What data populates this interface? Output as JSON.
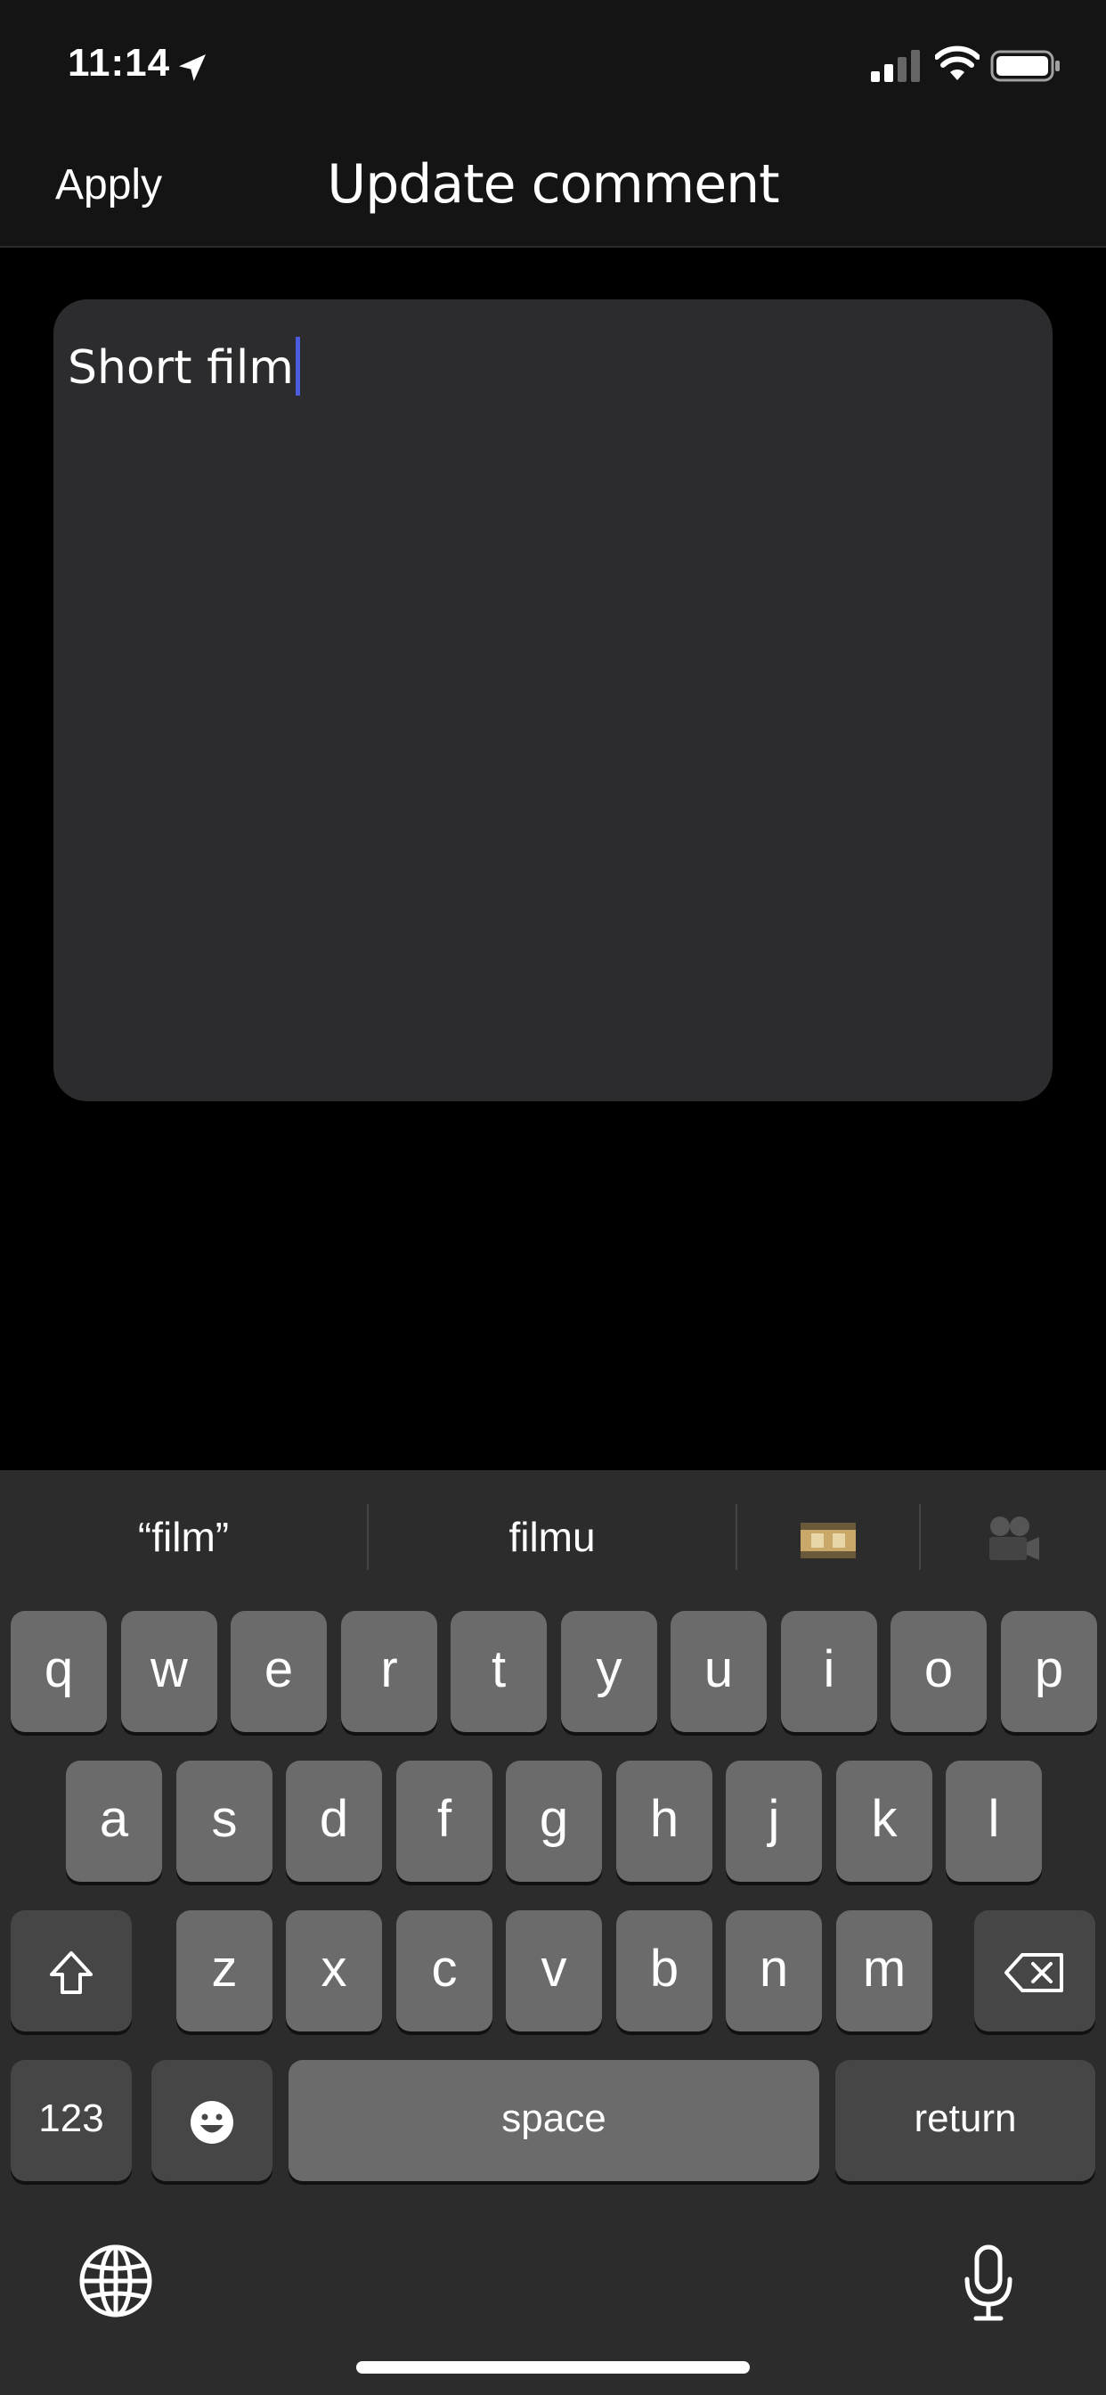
{
  "status_bar": {
    "time": "11:14"
  },
  "nav": {
    "apply_label": "Apply",
    "title": "Update comment"
  },
  "comment": {
    "value": "Short film"
  },
  "keyboard": {
    "suggestions": [
      "“film”",
      "filmu",
      "film-frames-emoji",
      "movie-camera-emoji"
    ],
    "row1": [
      "q",
      "w",
      "e",
      "r",
      "t",
      "y",
      "u",
      "i",
      "o",
      "p"
    ],
    "row2": [
      "a",
      "s",
      "d",
      "f",
      "g",
      "h",
      "j",
      "k",
      "l"
    ],
    "row3": [
      "z",
      "x",
      "c",
      "v",
      "b",
      "n",
      "m"
    ],
    "numbers_label": "123",
    "space_label": "space",
    "return_label": "return"
  },
  "colors": {
    "caret": "#4a5cdb",
    "key": "#6b6b6b",
    "key_dark": "#464646",
    "box": "#2c2c2e"
  }
}
